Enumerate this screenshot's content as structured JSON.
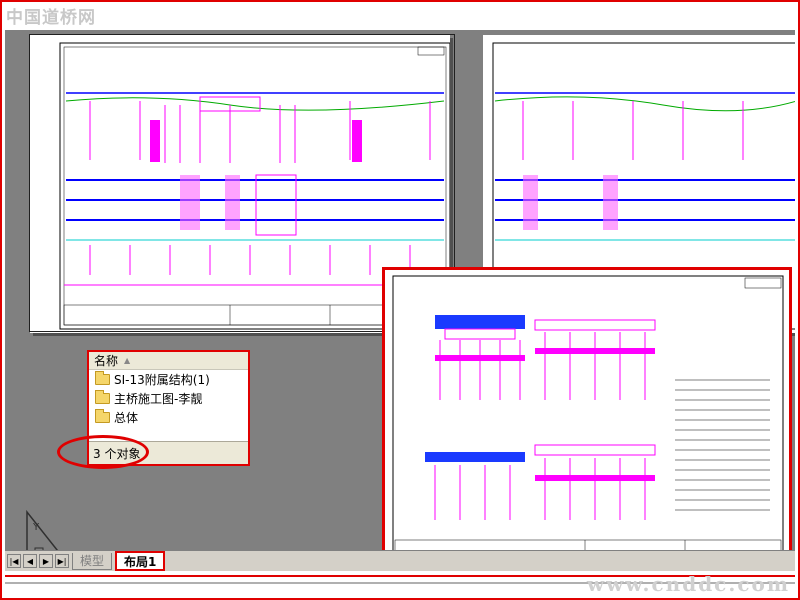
{
  "watermark": {
    "top_left": "中国道桥网",
    "bottom_right": "www.cnddc.com"
  },
  "explorer": {
    "column_header": "名称",
    "items": [
      {
        "label": "SI-13附属结构(1)",
        "icon": "folder-icon"
      },
      {
        "label": "主桥施工图-李靓",
        "icon": "folder-icon"
      },
      {
        "label": "总体",
        "icon": "folder-icon"
      }
    ],
    "status": "3 个对象"
  },
  "layout_tabs": {
    "nav_buttons": [
      "first-tab",
      "previous-tab",
      "next-tab",
      "last-tab"
    ],
    "model": "模型",
    "active": "布局1"
  },
  "colors": {
    "highlight": "#e00000",
    "canvas": "#808080",
    "line_magenta": "#ff00ff",
    "line_blue": "#0000ff",
    "line_green": "#00aa00"
  }
}
